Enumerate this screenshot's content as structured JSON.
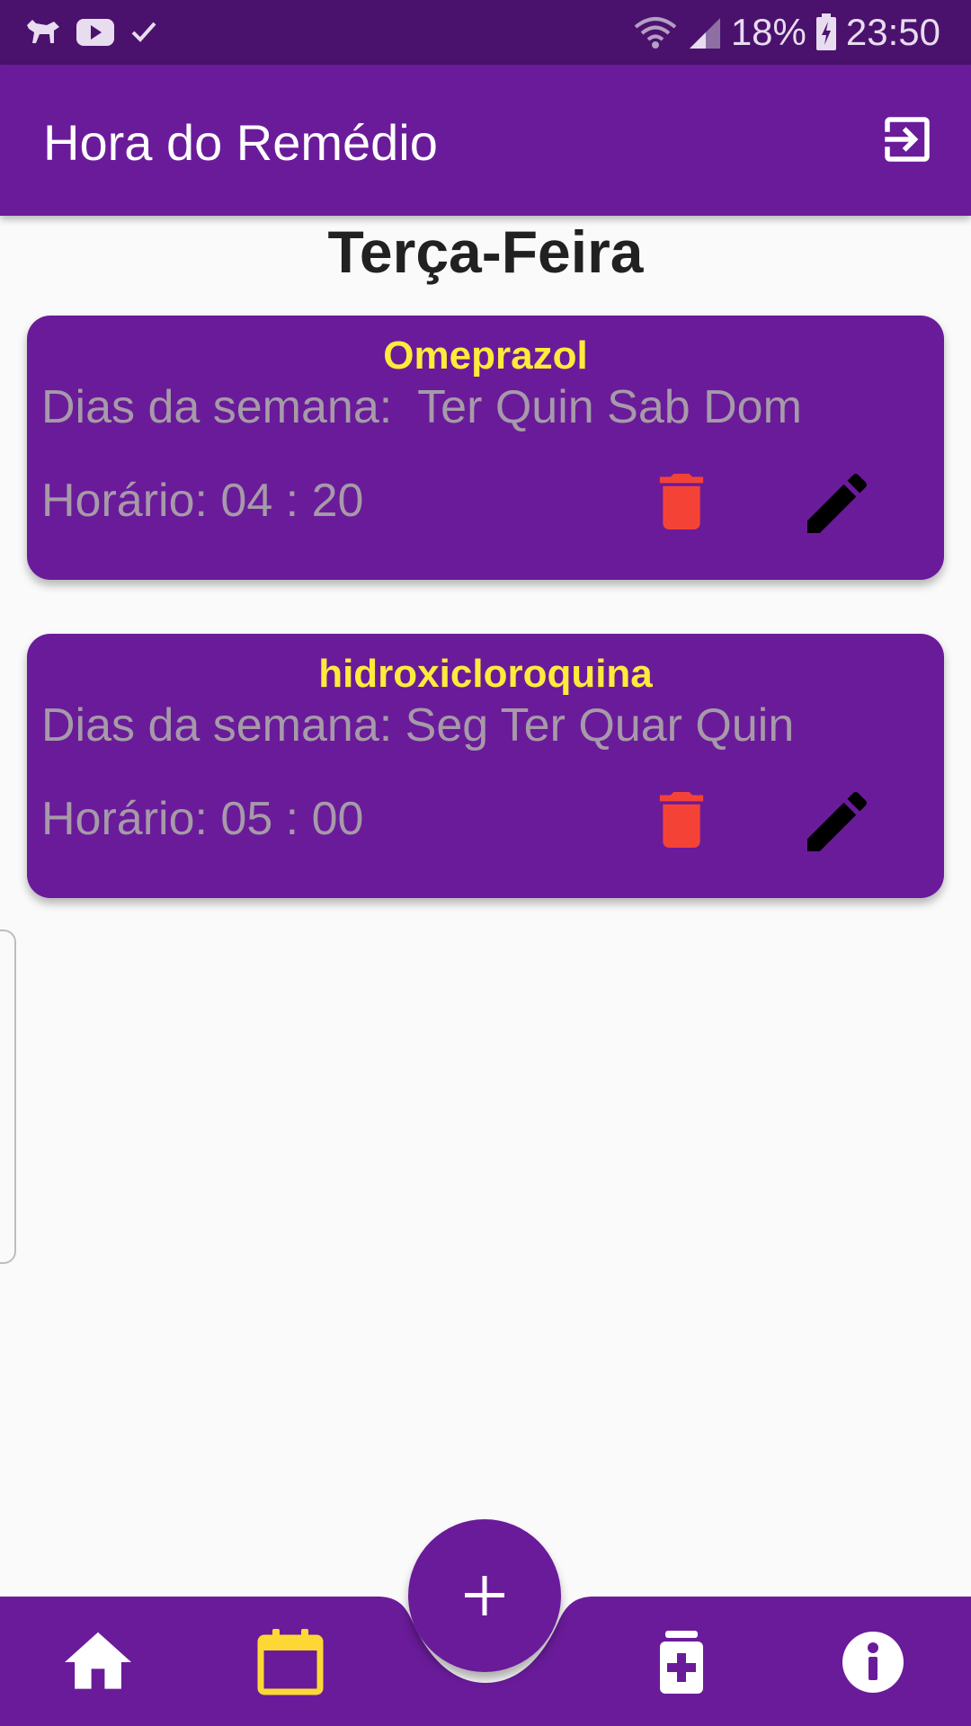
{
  "status_bar": {
    "battery": "18%",
    "time": "23:50"
  },
  "app_bar": {
    "title": "Hora do Remédio"
  },
  "day_title": "Terça-Feira",
  "medications": [
    {
      "name": "Omeprazol",
      "days": "Dias da semana:  Ter Quin Sab Dom",
      "time": "Horário: 04 : 20"
    },
    {
      "name": "hidroxicloroquina",
      "days": "Dias da semana: Seg Ter Quar Quin",
      "time": "Horário: 05 : 00"
    }
  ],
  "colors": {
    "primary": "#6a1b9a",
    "status_bar": "#4a126d",
    "accent_yellow": "#ffeb3b",
    "active_nav": "#fdd835",
    "delete": "#f44336",
    "edit": "#000000",
    "muted_text": "#a69aa8"
  },
  "bottom_nav": {
    "items": [
      {
        "icon": "home-icon",
        "active": false
      },
      {
        "icon": "calendar-icon",
        "active": true
      },
      {
        "icon": "medication-add-icon",
        "active": false
      },
      {
        "icon": "info-icon",
        "active": false
      }
    ],
    "fab_icon": "plus-icon"
  }
}
